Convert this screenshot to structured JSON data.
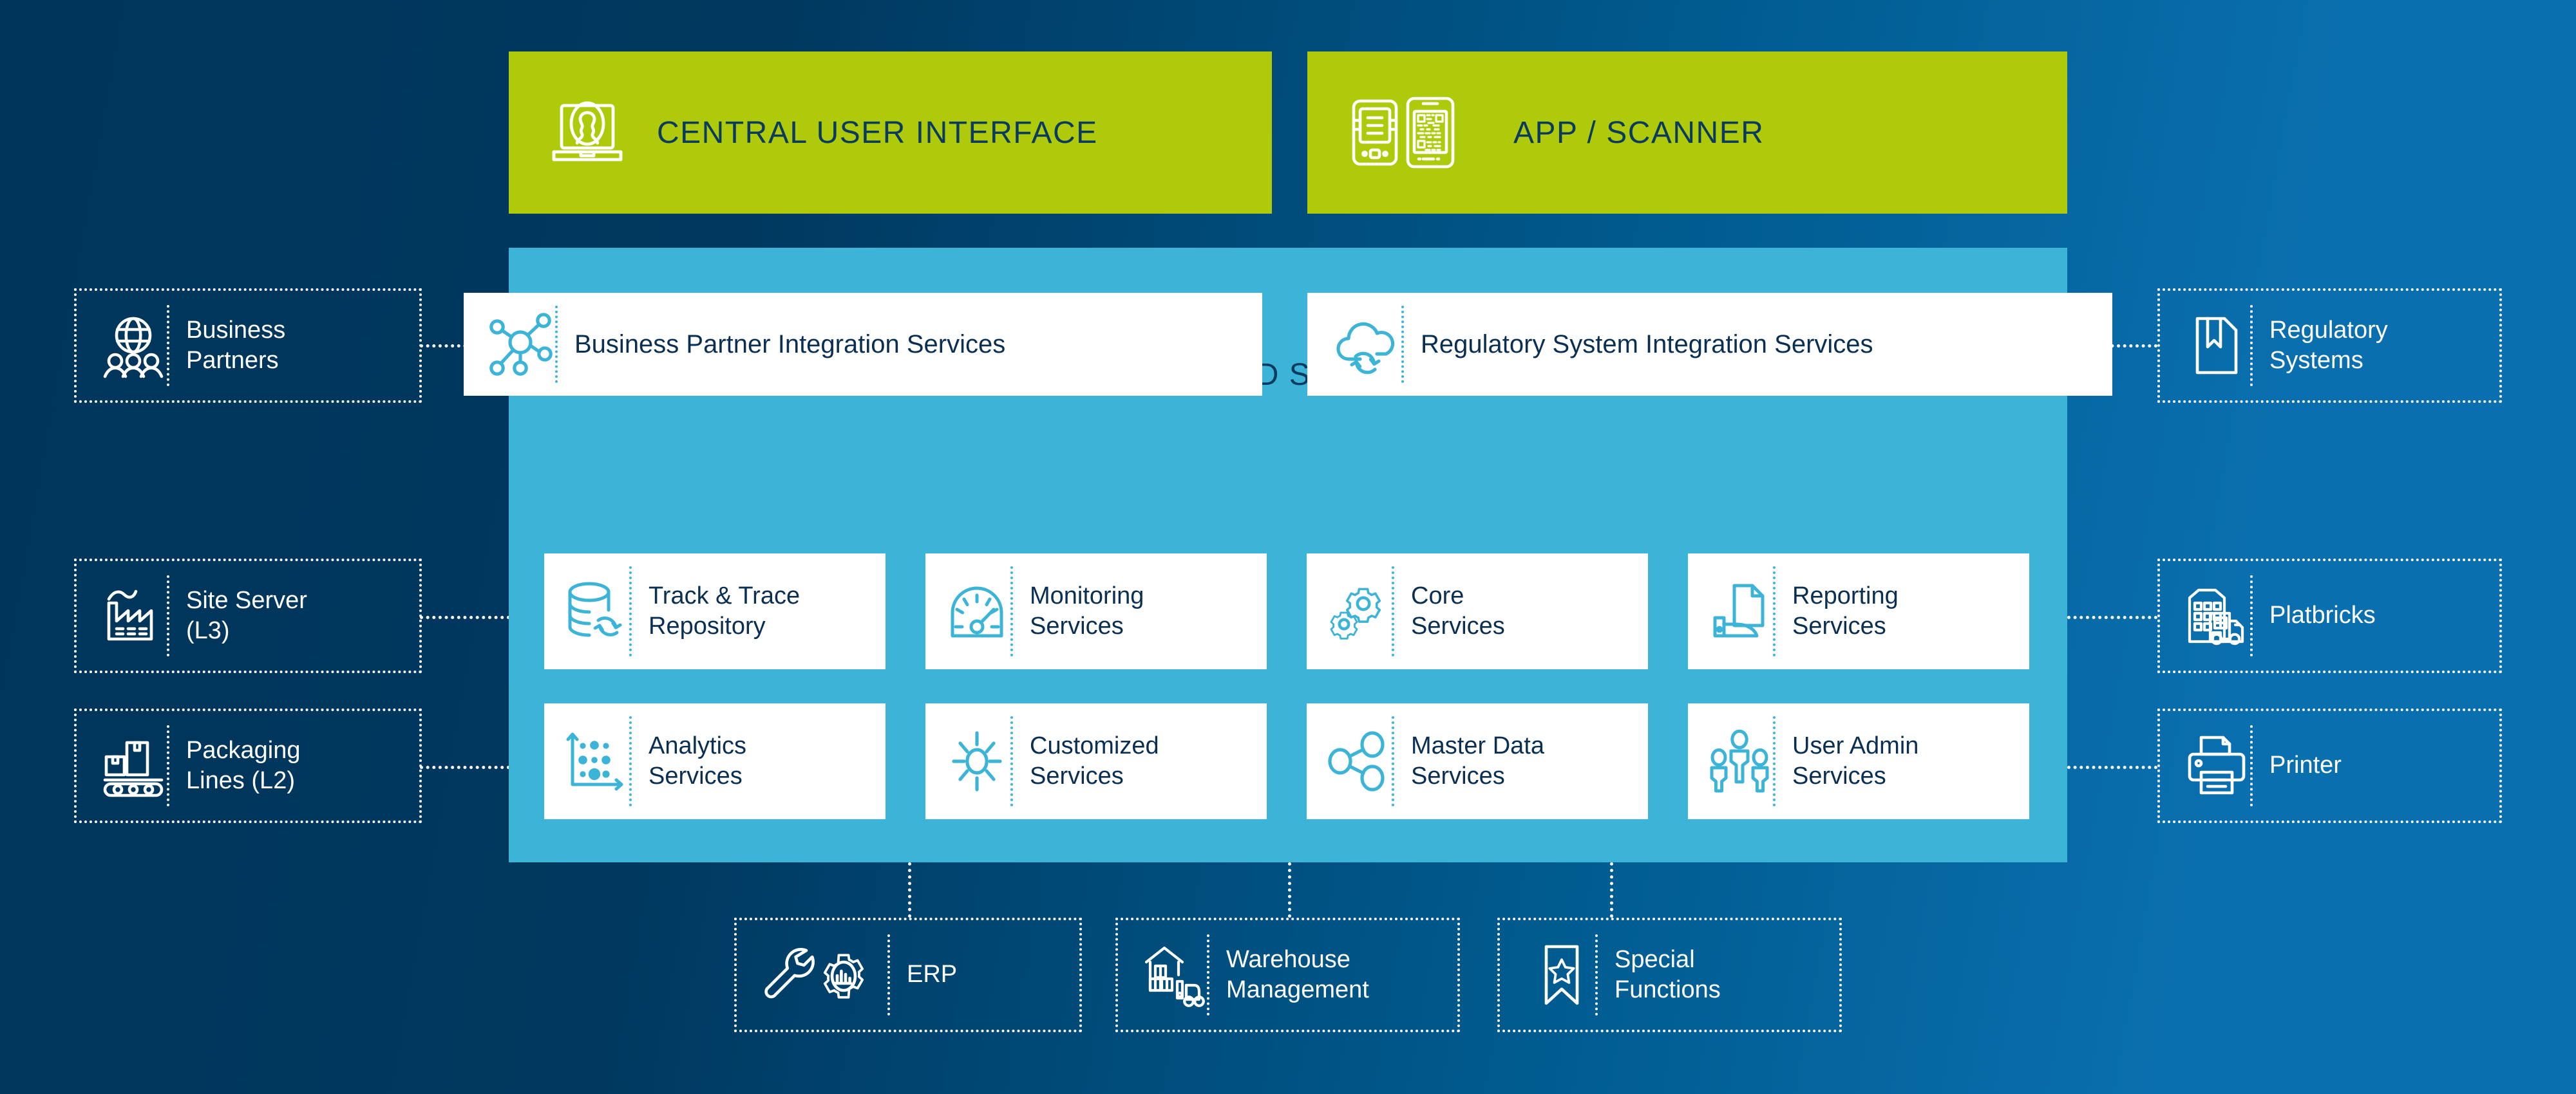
{
  "theme": {
    "bg_left": "#00355a",
    "bg_right": "#0a6fae",
    "accent_green": "#afca0b",
    "accent_cyan": "#3cb4d7",
    "text_navy": "#0a2f52",
    "white": "#ffffff"
  },
  "top_bars": [
    {
      "label": "CENTRAL USER INTERFACE",
      "icon": "laptop-user-icon"
    },
    {
      "label": "APP / SCANNER",
      "icon": "app-scanner-icon"
    }
  ],
  "backend": {
    "title": "BACKEND SERVICES",
    "integration_cards": [
      {
        "label": "Business Partner Integration Services",
        "icon": "network-nodes-icon"
      },
      {
        "label": "Regulatory System Integration Services",
        "icon": "cloud-sync-icon"
      }
    ],
    "service_cards": [
      {
        "label": "Track & Trace\nRepository",
        "icon": "database-sync-icon"
      },
      {
        "label": "Monitoring\nServices",
        "icon": "gauge-icon"
      },
      {
        "label": "Core\nServices",
        "icon": "gears-icon"
      },
      {
        "label": "Reporting\nServices",
        "icon": "document-printer-icon"
      },
      {
        "label": "Analytics\nServices",
        "icon": "scatter-chart-icon"
      },
      {
        "label": "Customized\nServices",
        "icon": "sun-burst-icon"
      },
      {
        "label": "Master Data\nServices",
        "icon": "share-nodes-icon"
      },
      {
        "label": "User Admin\nServices",
        "icon": "users-group-icon"
      }
    ]
  },
  "left_nodes": [
    {
      "label": "Business\nPartners",
      "icon": "globe-people-icon"
    },
    {
      "label": "Site Server\n(L3)",
      "icon": "factory-icon"
    },
    {
      "label": "Packaging\nLines (L2)",
      "icon": "packaging-line-icon"
    }
  ],
  "right_nodes": [
    {
      "label": "Regulatory\nSystems",
      "icon": "document-bookmark-icon"
    },
    {
      "label": "Platbricks",
      "icon": "building-truck-icon"
    },
    {
      "label": "Printer",
      "icon": "printer-icon"
    }
  ],
  "bottom_nodes": [
    {
      "label": "ERP",
      "icon": "wrench-gear-chart-icon"
    },
    {
      "label": "Warehouse\nManagement",
      "icon": "warehouse-forklift-icon"
    },
    {
      "label": "Special\nFunctions",
      "icon": "bookmark-star-icon"
    }
  ]
}
